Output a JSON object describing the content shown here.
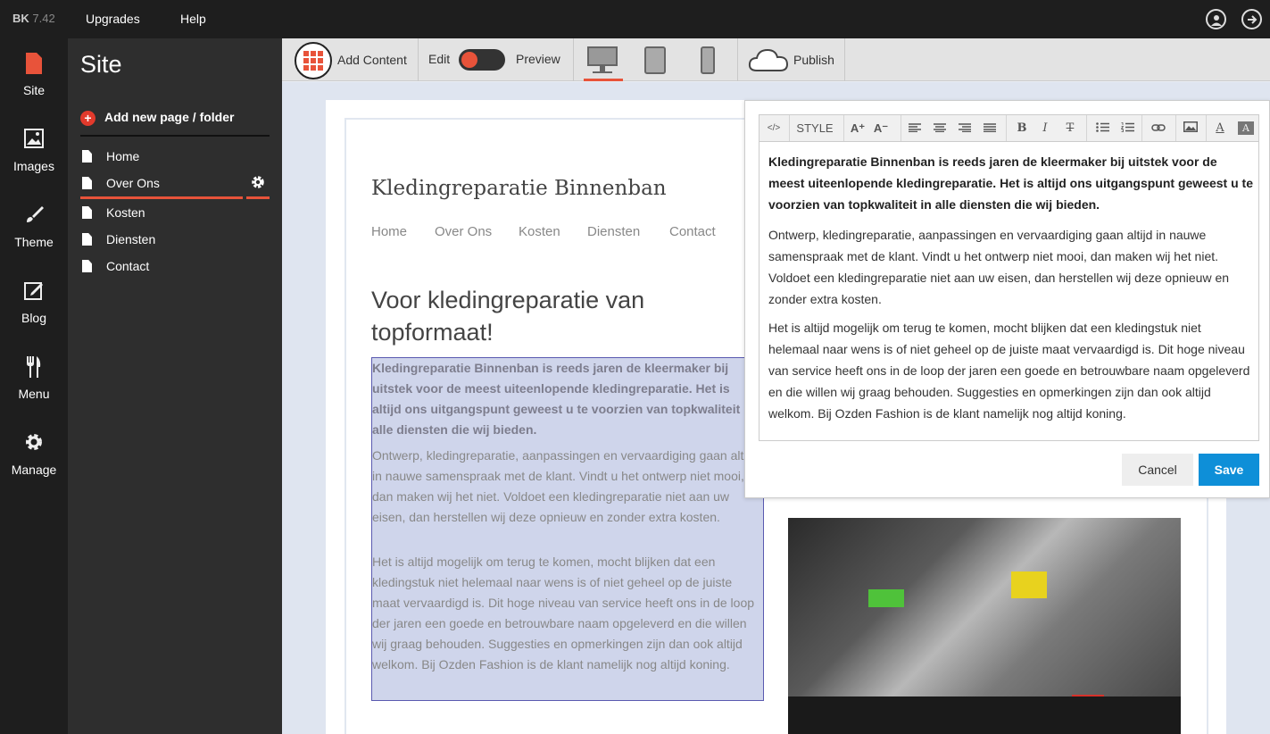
{
  "app": {
    "brand": "BK",
    "version": "7.42",
    "nav": [
      "Upgrades",
      "Help"
    ],
    "icons": [
      "account-icon",
      "logout-icon"
    ]
  },
  "rail": [
    {
      "label": "Site",
      "icon": "site-icon",
      "active": true
    },
    {
      "label": "Images",
      "icon": "images-icon"
    },
    {
      "label": "Theme",
      "icon": "theme-icon"
    },
    {
      "label": "Blog",
      "icon": "blog-icon"
    },
    {
      "label": "Menu",
      "icon": "menu-icon"
    },
    {
      "label": "Manage",
      "icon": "manage-icon"
    }
  ],
  "panel": {
    "title": "Site",
    "add_page": "Add new page / folder",
    "pages": [
      "Home",
      "Over Ons",
      "Kosten",
      "Diensten",
      "Contact"
    ],
    "active_page": "Over Ons"
  },
  "toolbar": {
    "add_content": "Add Content",
    "edit": "Edit",
    "preview": "Preview",
    "publish": "Publish",
    "active_device": "desktop"
  },
  "site": {
    "title": "Kledingreparatie Binnenban",
    "nav": [
      "Home",
      "Over Ons",
      "Kosten",
      "Diensten",
      "Contact"
    ],
    "hero": "Voor kledingreparatie van topformaat!",
    "para_bold": "Kledingreparatie Binnenban is reeds jaren de kleermaker bij uitstek voor de meest uiteenlopende kledingreparatie. Het is altijd ons uitgangspunt geweest u te voorzien van topkwaliteit in alle diensten die wij bieden.",
    "para_2": "Ontwerp, kledingreparatie, aanpassingen en vervaardiging gaan altijd in nauwe samenspraak met de klant. Vindt u het ontwerp niet mooi, dan maken wij het niet. Voldoet een kledingreparatie niet aan uw eisen, dan herstellen wij deze opnieuw en zonder extra kosten.",
    "para_3": "Het is altijd mogelijk om terug te komen, mocht blijken dat een kledingstuk niet helemaal naar wens is of niet geheel op de juiste maat vervaardigd is. Dit hoge niveau van service heeft ons in de loop der jaren een goede en betrouwbare naam opgeleverd en die willen wij graag behouden. Suggesties en opmerkingen zijn dan ook altijd welkom. Bij Ozden Fashion is de klant namelijk nog altijd koning."
  },
  "editor": {
    "toolbar": {
      "code": "</>",
      "style": "STYLE",
      "font_up": "A⁺",
      "font_down": "A⁻",
      "bold": "B",
      "italic": "I",
      "strike": "T",
      "font_color": "A",
      "bg_color": "A"
    },
    "cancel": "Cancel",
    "save": "Save"
  },
  "colors": {
    "accent": "#e8533a",
    "save": "#0e8fd8",
    "selection": "#cfd5eb"
  }
}
